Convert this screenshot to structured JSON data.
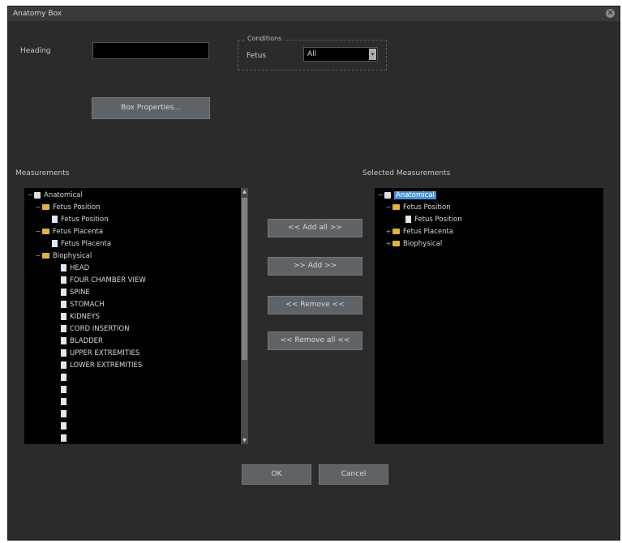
{
  "dialog": {
    "title": "Anatomy Box",
    "close_glyph": "×"
  },
  "heading": {
    "label": "Heading",
    "value": ""
  },
  "conditions": {
    "group_label": "Conditions",
    "field_label": "Fetus",
    "selected": "All"
  },
  "buttons": {
    "box_properties": "Box Properties...",
    "add_all": "<< Add all >>",
    "add": ">> Add >>",
    "remove": "<< Remove <<",
    "remove_all": "<< Remove all <<",
    "ok": "OK",
    "cancel": "Cancel"
  },
  "measurements": {
    "label": "Measurements",
    "root": "Anatomical",
    "fetus_position": "Fetus Position",
    "fetus_position_child": "Fetus Position",
    "fetus_placenta": "Fetus Placenta",
    "fetus_placenta_child": "Fetus Placenta",
    "biophysical": "Biophysical",
    "items": [
      "HEAD",
      "FOUR CHAMBER VIEW",
      "SPINE",
      "STOMACH",
      "KIDNEYS",
      "CORD INSERTION",
      "BLADDER",
      "UPPER EXTREMITIES",
      "LOWER EXTREMITIES",
      "",
      "",
      "",
      "",
      "",
      "",
      ""
    ]
  },
  "selected_measurements": {
    "label": "Selected Measurements",
    "root": "Anatomical",
    "fetus_position": "Fetus Position",
    "fetus_position_child": "Fetus Position",
    "fetus_placenta": "Fetus Placenta",
    "biophysical": "Biophysical"
  },
  "icons": {
    "folder": "folder-icon",
    "file": "file-icon",
    "root": "root-node-icon"
  },
  "colors": {
    "dialog_bg": "#2b2b2b",
    "list_bg": "#000000",
    "button_bg": "#5e6368",
    "selection": "#4a90d9",
    "folder": "#e3b341"
  }
}
